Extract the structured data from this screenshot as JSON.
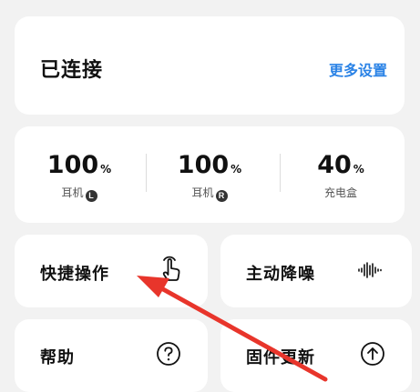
{
  "connection": {
    "status": "已连接",
    "more_settings": "更多设置"
  },
  "battery": {
    "left": {
      "value": "100",
      "unit": "%",
      "label": "耳机",
      "badge": "L"
    },
    "right": {
      "value": "100",
      "unit": "%",
      "label": "耳机",
      "badge": "R"
    },
    "case": {
      "value": "40",
      "unit": "%",
      "label": "充电盒"
    }
  },
  "tiles": {
    "shortcut": {
      "label": "快捷操作",
      "icon": "touch-gesture-icon"
    },
    "anc": {
      "label": "主动降噪",
      "icon": "sound-wave-icon"
    },
    "help": {
      "label": "帮助",
      "icon": "question-circle-icon"
    },
    "firmware": {
      "label": "固件更新",
      "icon": "arrow-up-circle-icon"
    }
  },
  "colors": {
    "accent": "#2b83e6",
    "annotation": "#e8352b",
    "background": "#f2f2f2",
    "card": "#ffffff"
  }
}
